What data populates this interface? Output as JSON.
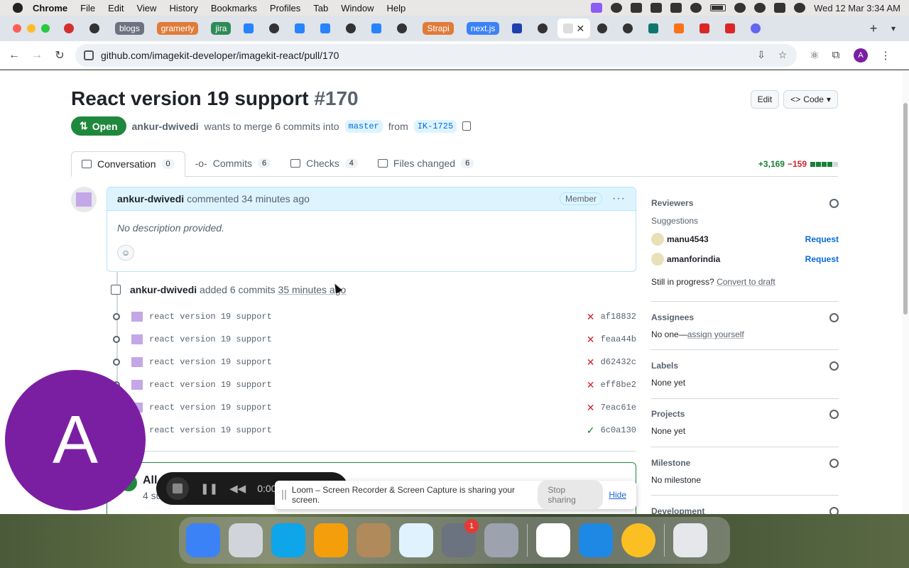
{
  "menubar": {
    "app_name": "Chrome",
    "items": [
      "File",
      "Edit",
      "View",
      "History",
      "Bookmarks",
      "Profiles",
      "Tab",
      "Window",
      "Help"
    ],
    "clock": "Wed 12 Mar  3:34 AM"
  },
  "tabs": {
    "pills": [
      {
        "label": "blogs",
        "color": "#6b7280"
      },
      {
        "label": "gramerly",
        "color": "#e07b39"
      },
      {
        "label": "jira",
        "color": "#2e8b57"
      },
      {
        "label": "Strapi",
        "color": "#e07b39"
      },
      {
        "label": "next.js",
        "color": "#3b82f6"
      }
    ],
    "active_close": "✕",
    "new_tab": "+"
  },
  "address_bar": {
    "url": "github.com/imagekit-developer/imagekit-react/pull/170",
    "profile_initial": "A"
  },
  "pr": {
    "title": "React version 19 support",
    "number": "#170",
    "edit_label": "Edit",
    "code_label": "Code",
    "state": "Open",
    "author": "ankur-dwivedi",
    "merge_text": "wants to merge 6 commits into",
    "base_branch": "master",
    "from_text": "from",
    "head_branch": "IK-1725"
  },
  "tabnav": [
    {
      "label": "Conversation",
      "count": "0"
    },
    {
      "label": "Commits",
      "count": "6"
    },
    {
      "label": "Checks",
      "count": "4"
    },
    {
      "label": "Files changed",
      "count": "6"
    }
  ],
  "diffstat": {
    "additions": "+3,169",
    "deletions": "−159",
    "colors": [
      "#1a7f37",
      "#1a7f37",
      "#1a7f37",
      "#1a7f37",
      "#d1d9e0"
    ]
  },
  "comment": {
    "author": "ankur-dwivedi",
    "meta": "commented 34 minutes ago",
    "role": "Member",
    "body": "No description provided."
  },
  "timeline": {
    "author": "ankur-dwivedi",
    "action": "added 6 commits",
    "ago": "35 minutes ago",
    "commits": [
      {
        "message": "react version 19 support",
        "status": "fail",
        "sha": "af18832"
      },
      {
        "message": "react version 19 support",
        "status": "fail",
        "sha": "feaa44b"
      },
      {
        "message": "react version 19 support",
        "status": "fail",
        "sha": "d62432c"
      },
      {
        "message": "react version 19 support",
        "status": "fail",
        "sha": "eff8be2"
      },
      {
        "message": "react version 19 support",
        "status": "fail",
        "sha": "7eac61e"
      },
      {
        "message": "react version 19 support",
        "status": "ok",
        "sha": "6c0a130"
      }
    ]
  },
  "merge_box": {
    "title": "All",
    "subtitle": "4 su"
  },
  "sidebar": {
    "reviewers": {
      "heading": "Reviewers",
      "suggestions_label": "Suggestions",
      "suggested": [
        {
          "name": "manu4543",
          "action": "Request"
        },
        {
          "name": "amanforindia",
          "action": "Request"
        }
      ],
      "draft_prefix": "Still in progress?",
      "draft_link": "Convert to draft"
    },
    "assignees": {
      "heading": "Assignees",
      "prefix": "No one—",
      "link": "assign yourself"
    },
    "labels": {
      "heading": "Labels",
      "value": "None yet"
    },
    "projects": {
      "heading": "Projects",
      "value": "None yet"
    },
    "milestone": {
      "heading": "Milestone",
      "value": "No milestone"
    },
    "development": {
      "heading": "Development"
    }
  },
  "webcam": {
    "initial": "A"
  },
  "loom": {
    "time": "0:00",
    "message": "Loom – Screen Recorder & Screen Capture is sharing your screen.",
    "stop_label": "Stop sharing",
    "hide_label": "Hide"
  },
  "dock": {
    "apps": [
      {
        "name": "finder",
        "color": "#3b82f6"
      },
      {
        "name": "launchpad",
        "color": "#d1d5db"
      },
      {
        "name": "safari",
        "color": "#0ea5e9"
      },
      {
        "name": "photos",
        "color": "#f59e0b"
      },
      {
        "name": "contacts",
        "color": "#b08a5a"
      },
      {
        "name": "freeform",
        "color": "#e0f2fe"
      },
      {
        "name": "system-settings",
        "color": "#6b7280"
      },
      {
        "name": "iphone-mirroring",
        "color": "#9ca3af"
      },
      {
        "name": "slack",
        "color": "#ffffff"
      },
      {
        "name": "vscode",
        "color": "#1e88e5"
      },
      {
        "name": "chrome",
        "color": "#fbbf24"
      },
      {
        "name": "trash",
        "color": "#e5e7eb"
      }
    ],
    "settings_badge": "1"
  }
}
